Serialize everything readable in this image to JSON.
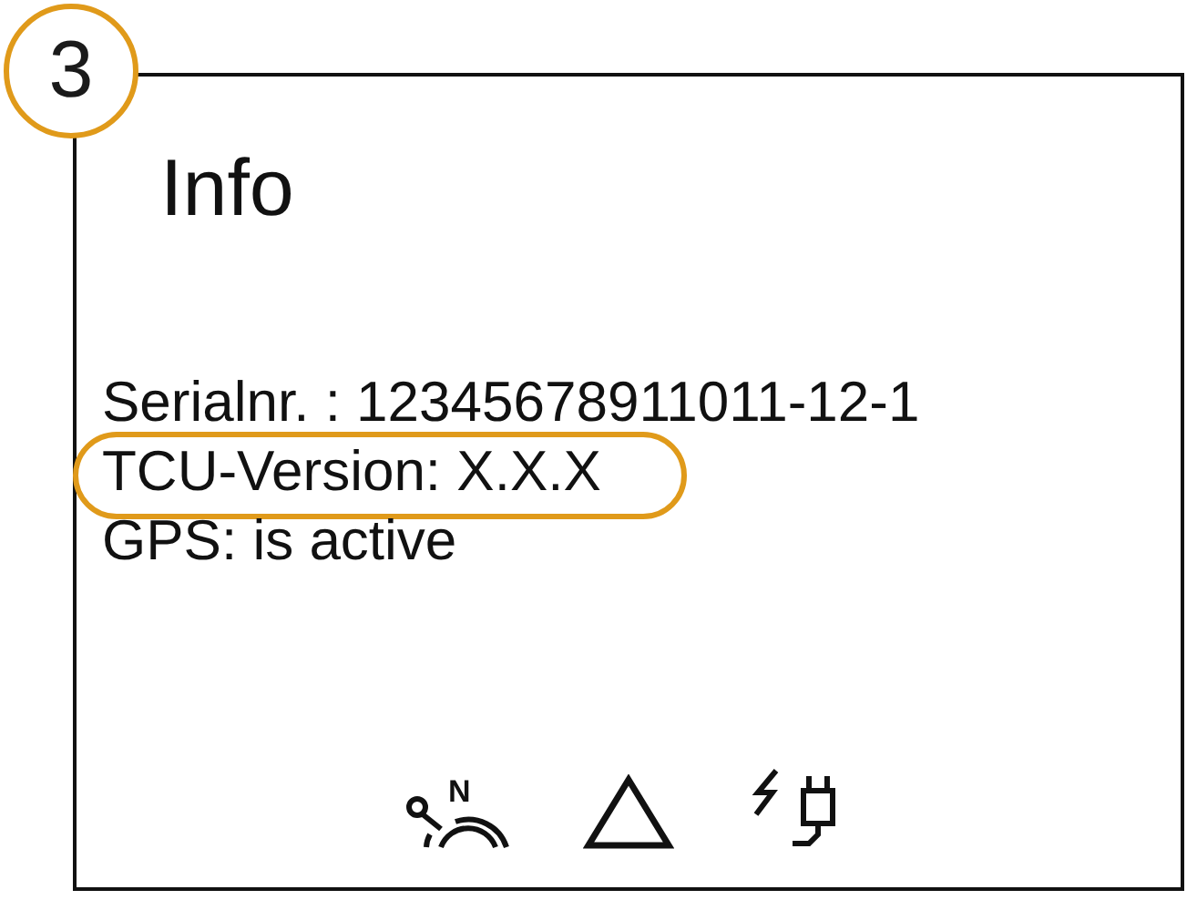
{
  "callout": {
    "number": "3"
  },
  "screen": {
    "title": "Info",
    "lines": [
      {
        "text": "Serialnr. : 12345678911011-12-1",
        "highlighted": false
      },
      {
        "text": "TCU-Version: X.X.X",
        "highlighted": true
      },
      {
        "text": "GPS: is active",
        "highlighted": false
      }
    ],
    "status_icons": [
      {
        "kind": "compass",
        "label": "N"
      },
      {
        "kind": "warning"
      },
      {
        "kind": "power"
      }
    ]
  }
}
